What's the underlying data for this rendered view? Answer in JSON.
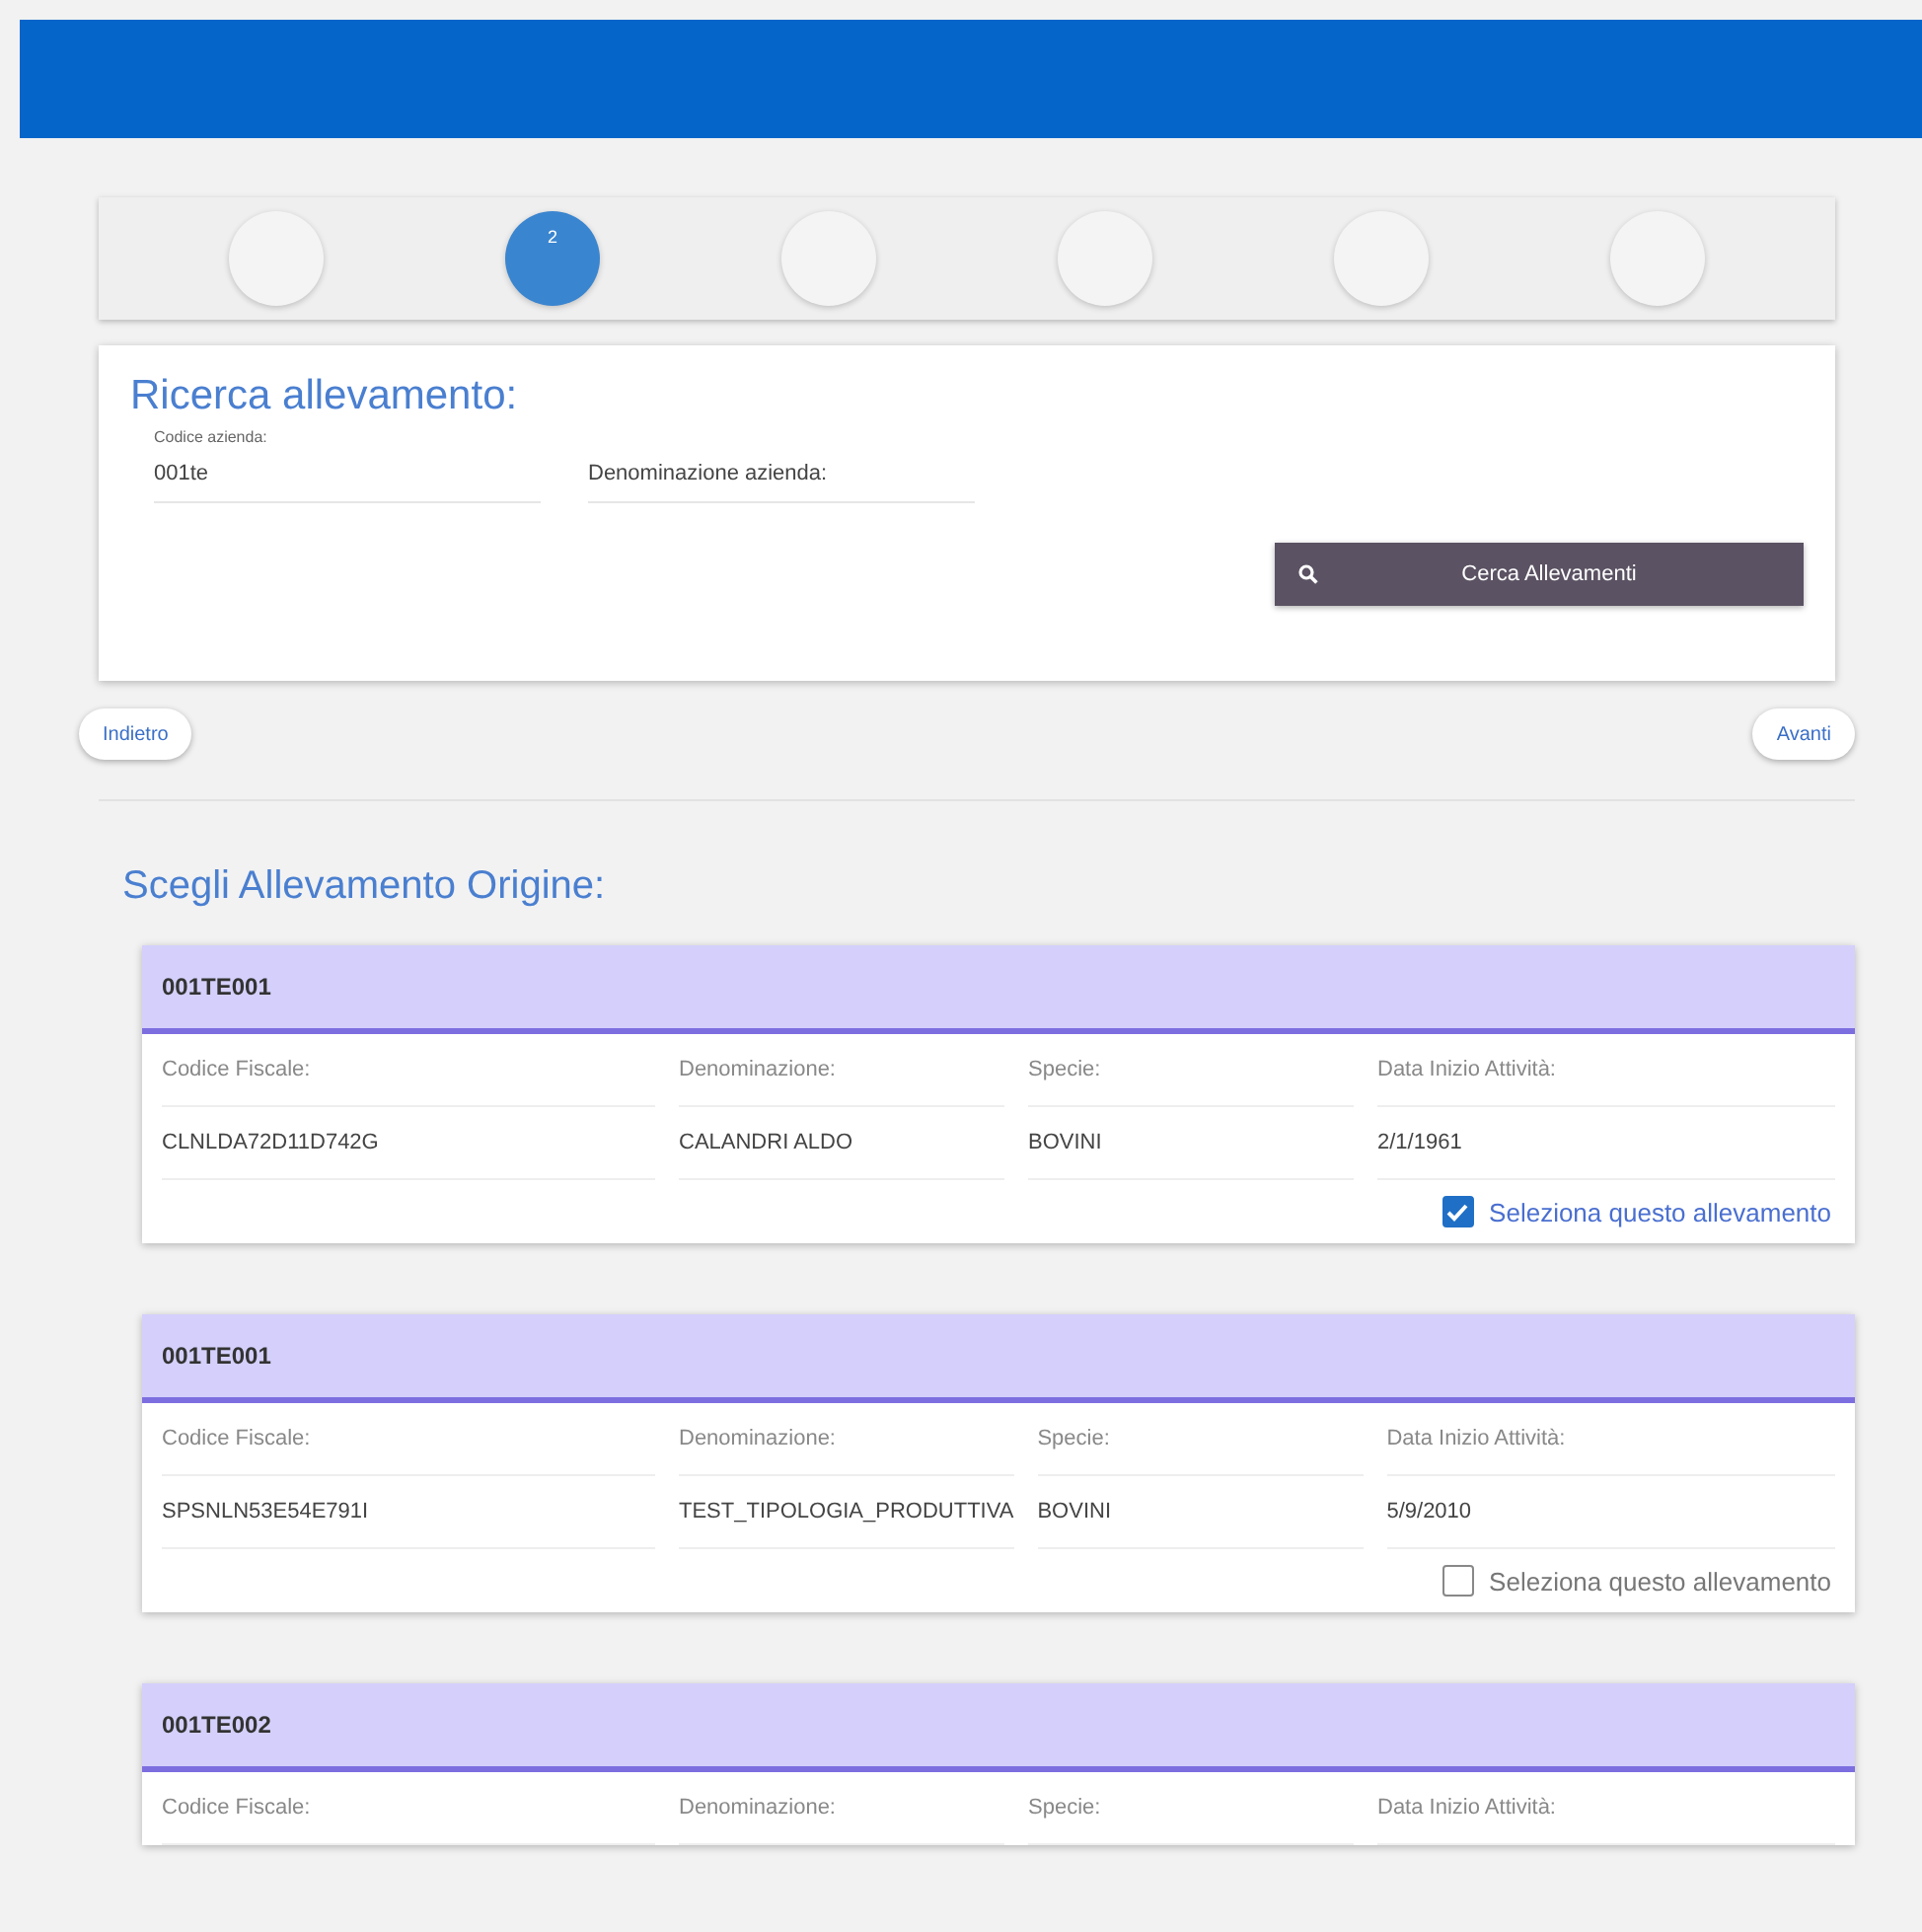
{
  "stepper": {
    "steps": [
      {
        "selected": false
      },
      {
        "label": "2",
        "selected": true
      },
      {
        "selected": false
      },
      {
        "selected": false
      },
      {
        "selected": false
      },
      {
        "selected": false
      }
    ]
  },
  "search": {
    "title": "Ricerca allevamento:",
    "fields": [
      {
        "label": "Codice azienda:",
        "value": "001te"
      },
      {
        "placeholder": "Denominazione azienda:"
      }
    ],
    "button": "Cerca Allevamenti"
  },
  "nav": {
    "back": "Indietro",
    "next": "Avanti"
  },
  "results": {
    "title": "Scegli Allevamento Origine:",
    "cards": [
      {
        "code": "001TE001",
        "fields": [
          {
            "label": "Codice Fiscale:",
            "value": "CLNLDA72D11D742G"
          },
          {
            "label": "Denominazione:",
            "value": "CALANDRI ALDO"
          },
          {
            "label": "Specie:",
            "value": "BOVINI"
          },
          {
            "label": "Data Inizio Attività:",
            "value": "2/1/1961"
          }
        ],
        "select_label": "Seleziona questo allevamento",
        "checked": true
      },
      {
        "code": "001TE001",
        "fields": [
          {
            "label": "Codice Fiscale:",
            "value": "SPSNLN53E54E791I"
          },
          {
            "label": "Denominazione:",
            "value": "TEST_TIPOLOGIA_PRODUTTIVA"
          },
          {
            "label": "Specie:",
            "value": "BOVINI"
          },
          {
            "label": "Data Inizio Attività:",
            "value": "5/9/2010"
          }
        ],
        "select_label": "Seleziona questo allevamento",
        "checked": false
      },
      {
        "code": "001TE002",
        "fields": [
          {
            "label": "Codice Fiscale:"
          },
          {
            "label": "Denominazione:"
          },
          {
            "label": "Specie:"
          },
          {
            "label": "Data Inizio Attività:"
          }
        ]
      }
    ]
  }
}
